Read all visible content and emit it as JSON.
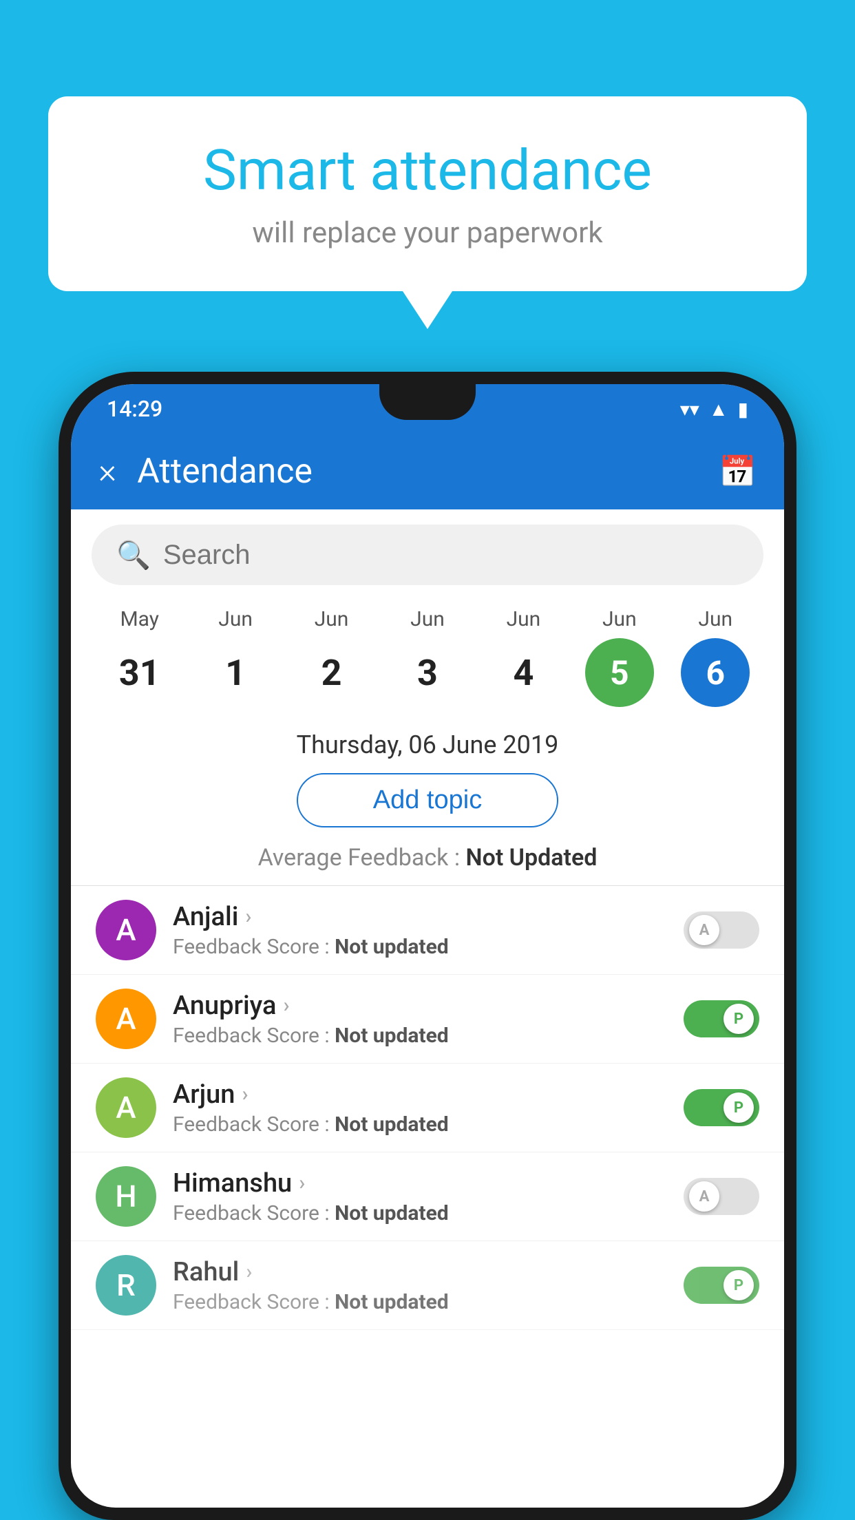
{
  "background_color": "#1bb8e8",
  "speech_bubble": {
    "title": "Smart attendance",
    "subtitle": "will replace your paperwork"
  },
  "status_bar": {
    "time": "14:29",
    "icons": [
      "wifi",
      "signal",
      "battery"
    ]
  },
  "app_bar": {
    "title": "Attendance",
    "close_label": "×"
  },
  "search": {
    "placeholder": "Search"
  },
  "calendar": {
    "days": [
      {
        "month": "May",
        "num": "31",
        "selected": ""
      },
      {
        "month": "Jun",
        "num": "1",
        "selected": ""
      },
      {
        "month": "Jun",
        "num": "2",
        "selected": ""
      },
      {
        "month": "Jun",
        "num": "3",
        "selected": ""
      },
      {
        "month": "Jun",
        "num": "4",
        "selected": ""
      },
      {
        "month": "Jun",
        "num": "5",
        "selected": "green"
      },
      {
        "month": "Jun",
        "num": "6",
        "selected": "blue"
      }
    ],
    "selected_date": "Thursday, 06 June 2019"
  },
  "add_topic_label": "Add topic",
  "average_feedback": {
    "label": "Average Feedback : ",
    "value": "Not Updated"
  },
  "students": [
    {
      "name": "Anjali",
      "avatar_letter": "A",
      "avatar_color": "purple",
      "feedback_label": "Feedback Score : ",
      "feedback_value": "Not updated",
      "toggle": "off",
      "toggle_letter": "A"
    },
    {
      "name": "Anupriya",
      "avatar_letter": "A",
      "avatar_color": "orange",
      "feedback_label": "Feedback Score : ",
      "feedback_value": "Not updated",
      "toggle": "on",
      "toggle_letter": "P"
    },
    {
      "name": "Arjun",
      "avatar_letter": "A",
      "avatar_color": "light-green",
      "feedback_label": "Feedback Score : ",
      "feedback_value": "Not updated",
      "toggle": "on",
      "toggle_letter": "P"
    },
    {
      "name": "Himanshu",
      "avatar_letter": "H",
      "avatar_color": "green-dark",
      "feedback_label": "Feedback Score : ",
      "feedback_value": "Not updated",
      "toggle": "off",
      "toggle_letter": "A"
    },
    {
      "name": "Rahul",
      "avatar_letter": "R",
      "avatar_color": "teal",
      "feedback_label": "Feedback Score : ",
      "feedback_value": "Not updated",
      "toggle": "on",
      "toggle_letter": "P"
    }
  ]
}
